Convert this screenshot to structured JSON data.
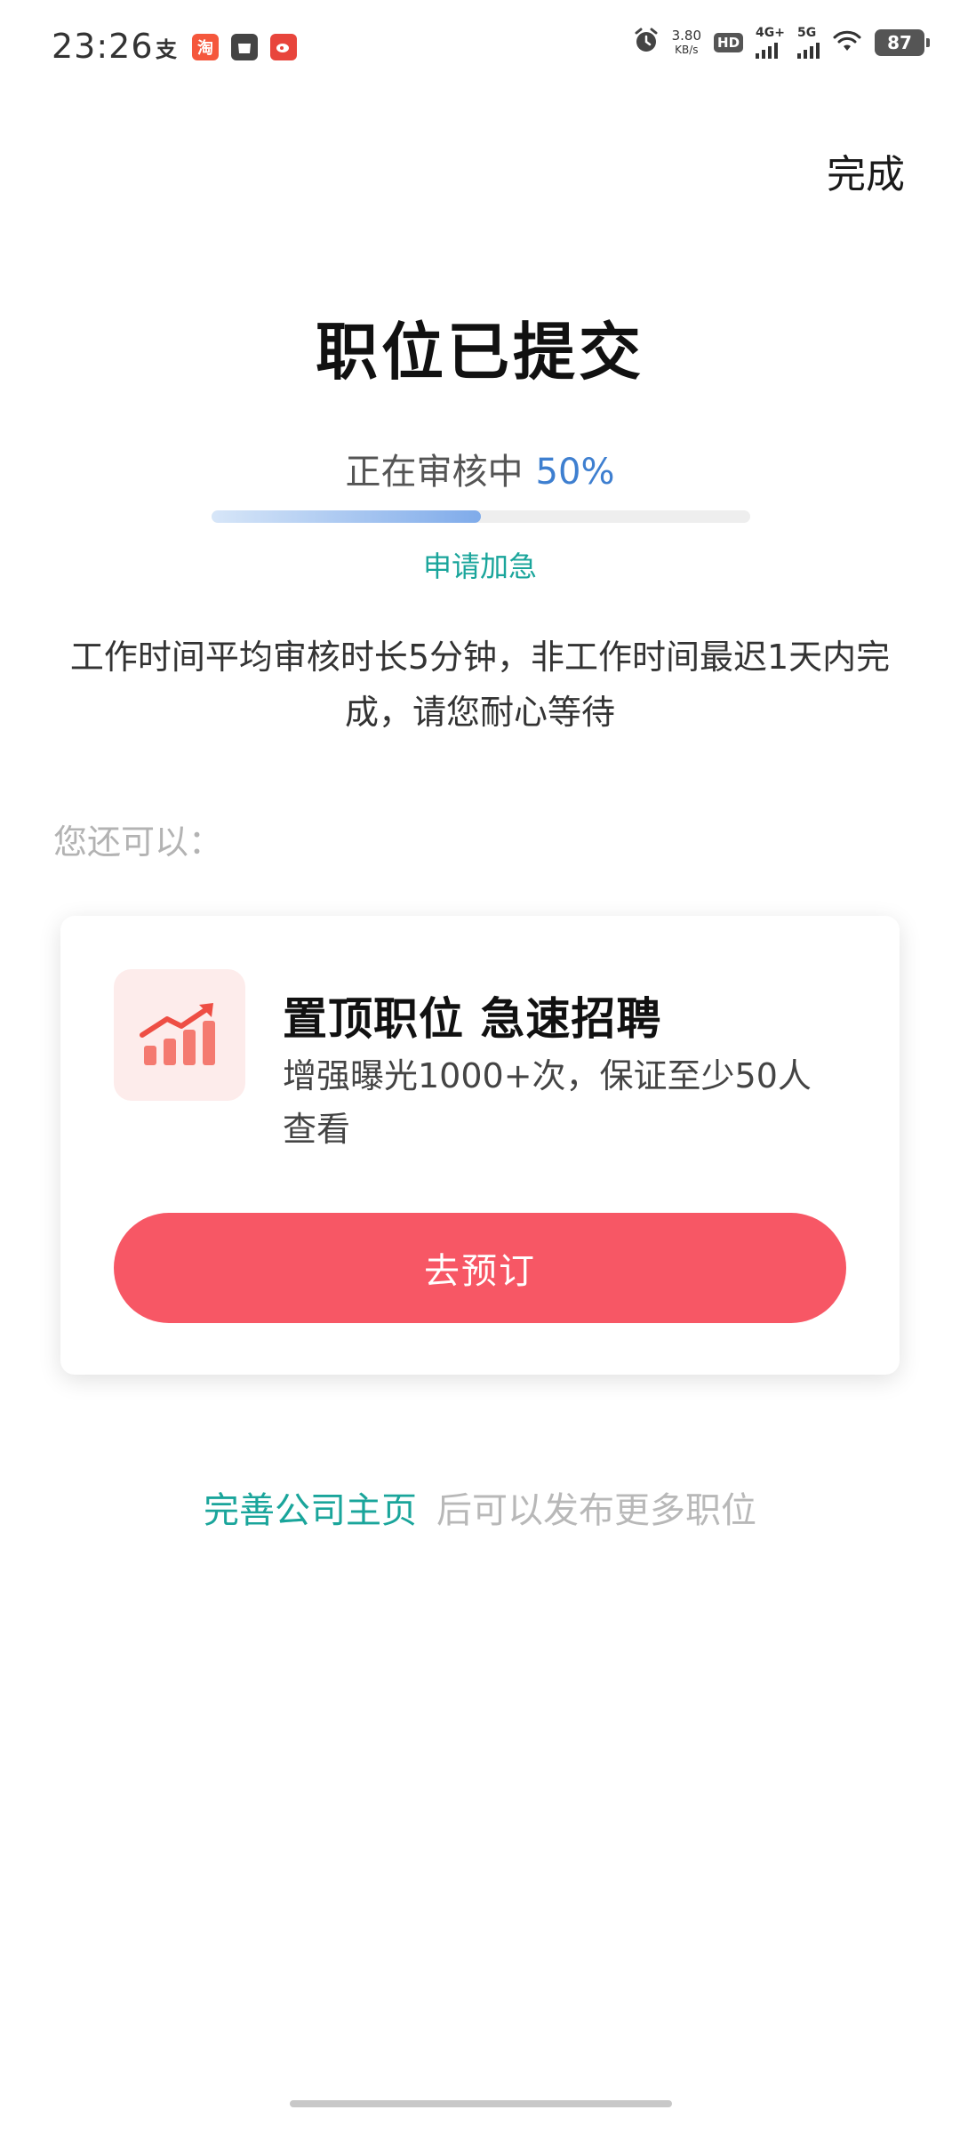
{
  "status_bar": {
    "time": "23:26",
    "app_icons": [
      "alipay-icon",
      "taobao-icon",
      "shopping-bag-icon",
      "weibo-icon"
    ],
    "net_speed_value": "3.80",
    "net_speed_unit": "KB/s",
    "hd_label": "HD",
    "network_4g": "4G+",
    "network_5g": "5G",
    "battery": "87"
  },
  "header": {
    "done_label": "完成"
  },
  "main": {
    "title": "职位已提交",
    "review_text": "正在审核中",
    "review_percent_text": "50%",
    "progress_fraction": 0.5,
    "urgent_link": "申请加急",
    "info_text": "工作时间平均审核时长5分钟，非工作时间最迟1天内完成，请您耐心等待",
    "you_can_label": "您还可以："
  },
  "promo_card": {
    "icon": "rising-chart-icon",
    "title": "置顶职位 急速招聘",
    "description": "增强曝光1000+次，保证至少50人查看",
    "button_label": "去预订"
  },
  "footer": {
    "link_text": "完善公司主页",
    "suffix_text": "后可以发布更多职位"
  },
  "colors": {
    "accent_teal": "#1aa59b",
    "progress_blue": "#3e7fd0",
    "button_red": "#f75765"
  }
}
